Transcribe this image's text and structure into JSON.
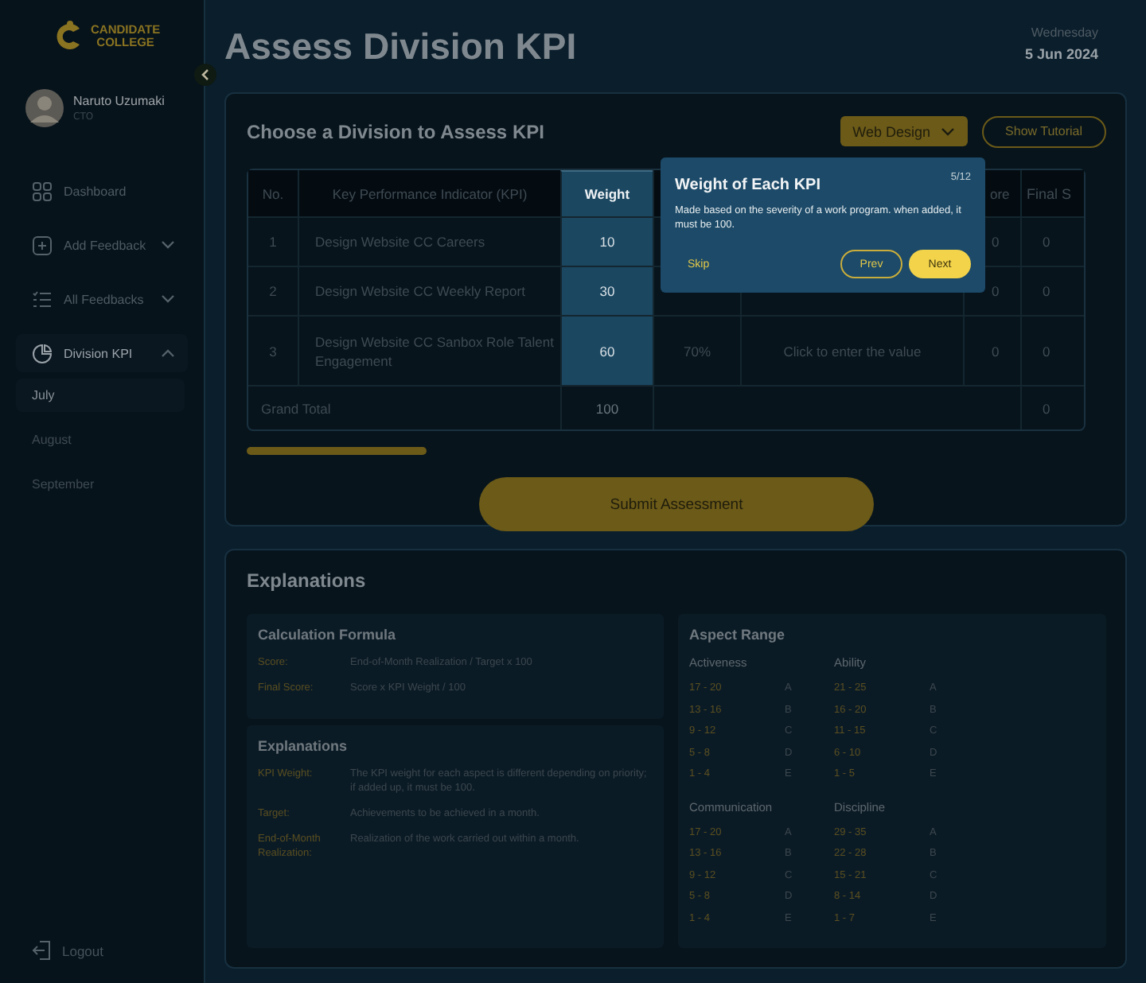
{
  "sidebar": {
    "logo": [
      "CANDIDATE",
      "COLLEGE"
    ],
    "user": {
      "name": "Naruto Uzumaki",
      "role": "CTO"
    },
    "items": [
      {
        "label": "Dashboard",
        "kind": "link",
        "selected": false
      },
      {
        "label": "Add Feedback",
        "kind": "group",
        "selected": false,
        "expanded": false
      },
      {
        "label": "All Feedbacks",
        "kind": "group",
        "selected": false,
        "expanded": false
      },
      {
        "label": "Division KPI",
        "kind": "group",
        "selected": true,
        "expanded": true,
        "children": [
          {
            "label": "July",
            "selected": true
          },
          {
            "label": "August",
            "selected": false
          },
          {
            "label": "September",
            "selected": false
          }
        ]
      }
    ],
    "logout": "Logout"
  },
  "header": {
    "title": "Assess Division KPI",
    "day": "Wednesday",
    "date": "5 Jun 2024"
  },
  "kpi_card": {
    "title": "Choose a Division to Assess KPI",
    "division": "Web Design",
    "tutorial_button": "Show Tutorial",
    "table": {
      "columns": [
        {
          "label": "No."
        },
        {
          "label": "Key Performance Indicator (KPI)"
        },
        {
          "label": "Weight",
          "highlighted": true
        },
        {},
        {},
        {
          "label": "ore"
        },
        {
          "label": "Final S"
        }
      ],
      "rows": [
        {
          "no": "1",
          "kpi": "Design Website CC Careers",
          "weight": "10",
          "score": "0",
          "final_score": "0"
        },
        {
          "no": "2",
          "kpi": "Design Website CC Weekly Report",
          "weight": "30",
          "score": "0",
          "final_score": "0"
        },
        {
          "no": "3",
          "kpi": "Design Website CC Sanbox Role Talent Engagement",
          "weight": "60",
          "target": "70%",
          "realization": "Click to enter the value",
          "score": "0",
          "final_score": "0"
        }
      ],
      "total": {
        "label": "Grand Total",
        "weight": "100",
        "final_score": "0"
      }
    },
    "submit": "Submit Assessment"
  },
  "tooltip": {
    "title": "Weight of Each KPI",
    "step": "5/12",
    "text": "Made based on the severity of a work program. when added, it must be 100.",
    "skip": "Skip",
    "prev": "Prev",
    "next": "Next"
  },
  "explanations": {
    "title": "Explanations",
    "formula": {
      "title": "Calculation Formula",
      "items": [
        {
          "term": "Score:",
          "text": "End-of-Month Realization / Target x 100"
        },
        {
          "term": "Final Score:",
          "text": "Score x KPI Weight / 100"
        }
      ]
    },
    "terms": {
      "title": "Explanations",
      "items": [
        {
          "term": "KPI Weight:",
          "text": "The KPI weight for each aspect is different depending on priority; if added up, it must be 100."
        },
        {
          "term": "Target:",
          "text": "Achievements to be achieved in a month."
        },
        {
          "term": "End-of-Month Realization:",
          "text": "Realization of the work carried out within a month."
        }
      ]
    },
    "aspect_range": {
      "title": "Aspect Range",
      "groups": [
        {
          "name": "Activeness",
          "ranges": [
            {
              "range": "17 - 20",
              "grade": "A"
            },
            {
              "range": "13 - 16",
              "grade": "B"
            },
            {
              "range": "9 - 12",
              "grade": "C"
            },
            {
              "range": "5 - 8",
              "grade": "D"
            },
            {
              "range": "1 - 4",
              "grade": "E"
            }
          ]
        },
        {
          "name": "Ability",
          "ranges": [
            {
              "range": "21 - 25",
              "grade": "A"
            },
            {
              "range": "16 - 20",
              "grade": "B"
            },
            {
              "range": "11 - 15",
              "grade": "C"
            },
            {
              "range": "6 - 10",
              "grade": "D"
            },
            {
              "range": "1 - 5",
              "grade": "E"
            }
          ]
        },
        {
          "name": "Communication",
          "ranges": [
            {
              "range": "17 - 20",
              "grade": "A"
            },
            {
              "range": "13 - 16",
              "grade": "B"
            },
            {
              "range": "9 - 12",
              "grade": "C"
            },
            {
              "range": "5 - 8",
              "grade": "D"
            },
            {
              "range": "1 - 4",
              "grade": "E"
            }
          ]
        },
        {
          "name": "Discipline",
          "ranges": [
            {
              "range": "29 - 35",
              "grade": "A"
            },
            {
              "range": "22 - 28",
              "grade": "B"
            },
            {
              "range": "15 - 21",
              "grade": "C"
            },
            {
              "range": "8 - 14",
              "grade": "D"
            },
            {
              "range": "1 - 7",
              "grade": "E"
            }
          ]
        }
      ]
    }
  }
}
